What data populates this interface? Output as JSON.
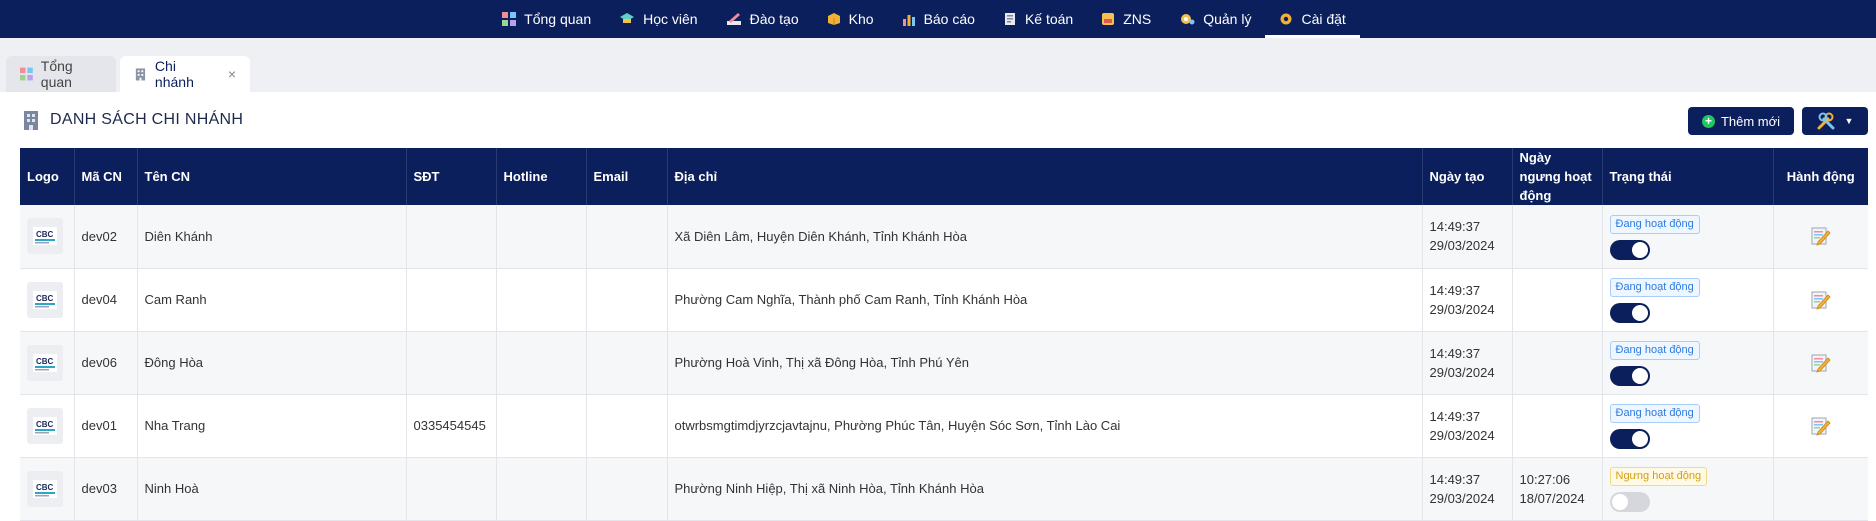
{
  "nav": {
    "items": [
      {
        "label": "Tổng quan",
        "icon": "dashboard-grid-icon",
        "active": false
      },
      {
        "label": "Học viên",
        "icon": "graduation-cap-icon",
        "active": false
      },
      {
        "label": "Đào tạo",
        "icon": "pencil-book-icon",
        "active": false
      },
      {
        "label": "Kho",
        "icon": "box-icon",
        "active": false
      },
      {
        "label": "Báo cáo",
        "icon": "bar-chart-icon",
        "active": false
      },
      {
        "label": "Kế toán",
        "icon": "ledger-icon",
        "active": false
      },
      {
        "label": "ZNS",
        "icon": "message-card-icon",
        "active": false
      },
      {
        "label": "Quản lý",
        "icon": "manager-gear-icon",
        "active": false
      },
      {
        "label": "Cài đặt",
        "icon": "settings-gear-icon",
        "active": true
      }
    ]
  },
  "tabs": [
    {
      "label": "Tổng quan",
      "icon": "dashboard-grid-icon"
    },
    {
      "label": "Chi nhánh",
      "icon": "building-icon",
      "close": "×"
    }
  ],
  "page": {
    "title": "DANH SÁCH CHI NHÁNH",
    "add_button": "Thêm mới",
    "tools_icon": "tools-icon",
    "dropdown_caret": "▼"
  },
  "table": {
    "headers": [
      "Logo",
      "Mã CN",
      "Tên CN",
      "SĐT",
      "Hotline",
      "Email",
      "Địa chỉ",
      "Ngày tạo",
      "Ngày ngưng hoạt động",
      "Trạng thái",
      "Hành động"
    ],
    "rows": [
      {
        "code": "dev02",
        "name": "Diên Khánh",
        "phone": "",
        "hotline": "",
        "email": "",
        "address": "Xã Diên Lâm, Huyện Diên Khánh, Tỉnh Khánh Hòa",
        "created_time": "14:49:37",
        "created_date": "29/03/2024",
        "stopped_time": "",
        "stopped_date": "",
        "status": "Đang hoạt động",
        "active": true,
        "editable": true
      },
      {
        "code": "dev04",
        "name": "Cam Ranh",
        "phone": "",
        "hotline": "",
        "email": "",
        "address": "Phường Cam Nghĩa, Thành phố Cam Ranh, Tỉnh Khánh Hòa",
        "created_time": "14:49:37",
        "created_date": "29/03/2024",
        "stopped_time": "",
        "stopped_date": "",
        "status": "Đang hoạt động",
        "active": true,
        "editable": true
      },
      {
        "code": "dev06",
        "name": "Đông Hòa",
        "phone": "",
        "hotline": "",
        "email": "",
        "address": "Phường Hoà Vinh, Thị xã Đông Hòa, Tỉnh Phú Yên",
        "created_time": "14:49:37",
        "created_date": "29/03/2024",
        "stopped_time": "",
        "stopped_date": "",
        "status": "Đang hoạt động",
        "active": true,
        "editable": true
      },
      {
        "code": "dev01",
        "name": "Nha Trang",
        "phone": "0335454545",
        "hotline": "",
        "email": "",
        "address": "otwrbsmgtimdjyrzcjavtajnu, Phường Phúc Tân, Huyện Sóc Sơn, Tỉnh Lào Cai",
        "created_time": "14:49:37",
        "created_date": "29/03/2024",
        "stopped_time": "",
        "stopped_date": "",
        "status": "Đang hoạt động",
        "active": true,
        "editable": true
      },
      {
        "code": "dev03",
        "name": "Ninh Hoà",
        "phone": "",
        "hotline": "",
        "email": "",
        "address": "Phường Ninh Hiệp, Thị xã Ninh Hòa, Tỉnh Khánh Hòa",
        "created_time": "14:49:37",
        "created_date": "29/03/2024",
        "stopped_time": "10:27:06",
        "stopped_date": "18/07/2024",
        "status": "Ngưng hoạt động",
        "active": false,
        "editable": false
      }
    ]
  },
  "colors": {
    "nav_bg": "#0b1f5c",
    "active_badge": "#2d7be0",
    "inactive_badge": "#d4a011",
    "add_icon": "#22c55e"
  }
}
